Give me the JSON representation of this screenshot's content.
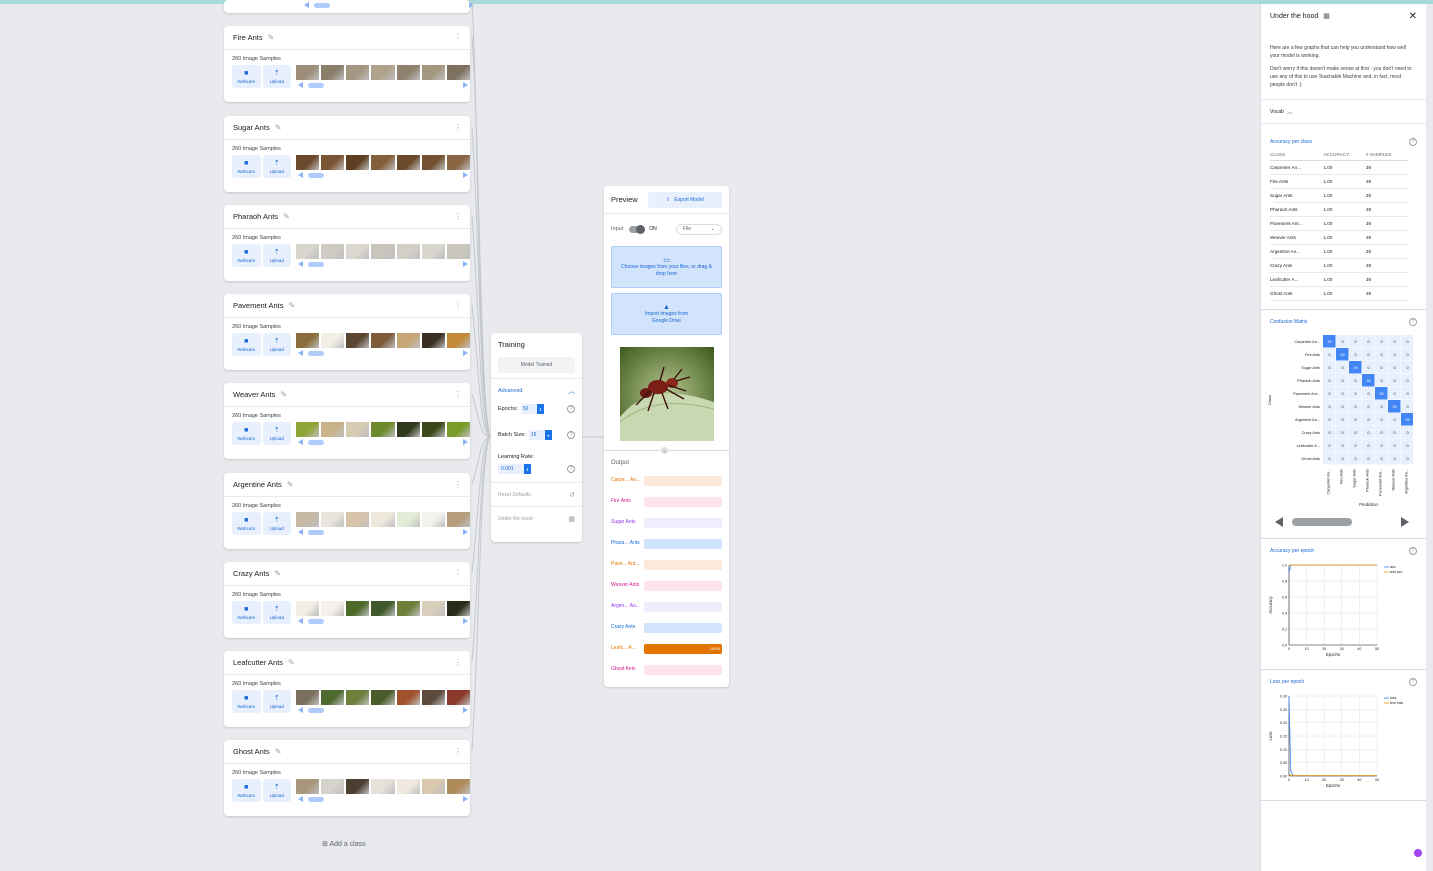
{
  "colors": {
    "accent": "#1a73e8",
    "orange": "#e37400",
    "pink": "#d01884",
    "purple": "#9334e6",
    "blue": "#1967d2"
  },
  "classes": [
    {
      "name": "Fire Ants",
      "samples": "260 Image Samples",
      "palette": [
        "#9c8c78",
        "#8a7d6a",
        "#a59883",
        "#b1a28b",
        "#8e826f",
        "#a4977f",
        "#7d705f"
      ]
    },
    {
      "name": "Sugar Ants",
      "samples": "260 Image Samples",
      "palette": [
        "#6b4a2b",
        "#7a5533",
        "#5e3f22",
        "#83603c",
        "#6a4a2a",
        "#735030",
        "#8a6644"
      ]
    },
    {
      "name": "Pharaoh Ants",
      "samples": "260 Image Samples",
      "palette": [
        "#d8d4ce",
        "#cfcbc4",
        "#dcd8d1",
        "#c9c4bc",
        "#d3cec7",
        "#d9d5cf",
        "#cbc6be"
      ]
    },
    {
      "name": "Pavement Ants",
      "samples": "260 Image Samples",
      "palette": [
        "#8a6d3b",
        "#f3efe6",
        "#5a4632",
        "#7e5c3a",
        "#c7a676",
        "#3b2e22",
        "#c48a3c"
      ]
    },
    {
      "name": "Weaver Ants",
      "samples": "260 Image Samples",
      "palette": [
        "#8fa53a",
        "#c9b48a",
        "#d6cbb3",
        "#6e8a2e",
        "#2f3a1d",
        "#3c4a1a",
        "#7a9b2a"
      ]
    },
    {
      "name": "Argentine Ants",
      "samples": "260 Image Samples",
      "palette": [
        "#c6b8a4",
        "#e9e4dc",
        "#d6c3a9",
        "#efe8dc",
        "#e3ecd6",
        "#f4f2ee",
        "#b59d7c"
      ]
    },
    {
      "name": "Crazy Ants",
      "samples": "260 Image Samples",
      "palette": [
        "#f1ece4",
        "#f5f1ea",
        "#4e6a2a",
        "#3e5a2a",
        "#6f7f3a",
        "#d9cdbb",
        "#2a2a1a"
      ]
    },
    {
      "name": "Leafcutter Ants",
      "samples": "260 Image Samples",
      "palette": [
        "#7a6e5c",
        "#4f6a2e",
        "#6d7f3a",
        "#4a5c2a",
        "#a0522d",
        "#5e4a3a",
        "#8a3a2a"
      ]
    },
    {
      "name": "Ghost Ants",
      "samples": "260 Image Samples",
      "palette": [
        "#a8967a",
        "#d6d2cc",
        "#4a3f30",
        "#e6e1d9",
        "#efe9df",
        "#d9c8ae",
        "#b08b5a"
      ]
    }
  ],
  "buttons": {
    "webcam": "Webcam",
    "upload": "Upload"
  },
  "add_class": "Add a class",
  "training": {
    "title": "Training",
    "status": "Model Trained",
    "advanced": "Advanced",
    "epochs_label": "Epochs:",
    "epochs_value": "50",
    "batch_label": "Batch Size:",
    "batch_value": "16",
    "lr_label": "Learning Rate:",
    "lr_value": "0.001",
    "reset": "Reset Defaults",
    "under_hood": "Under the hood"
  },
  "preview": {
    "title": "Preview",
    "export": "Export Model",
    "input_label": "Input",
    "toggle_state": "ON",
    "source": "File",
    "upload_text": "Choose images from your files, or drag & drop here",
    "drive_text": "Import images from Google Drive",
    "output_label": "Output",
    "outputs": [
      {
        "name": "Carpe... An...",
        "color": "#e37400",
        "bg": "#fde8dc",
        "value": 0
      },
      {
        "name": "Fire Ants",
        "color": "#d01884",
        "bg": "#fce4ec",
        "value": 0
      },
      {
        "name": "Sugar Ants",
        "color": "#9334e6",
        "bg": "#eeeefc",
        "value": 0
      },
      {
        "name": "Phara... Ants",
        "color": "#1967d2",
        "bg": "#d2e3fc",
        "value": 0
      },
      {
        "name": "Pave... Ant...",
        "color": "#e37400",
        "bg": "#fde8dc",
        "value": 0
      },
      {
        "name": "Weaver Ants",
        "color": "#d01884",
        "bg": "#fce4ec",
        "value": 0
      },
      {
        "name": "Argen... An...",
        "color": "#9334e6",
        "bg": "#eeeefc",
        "value": 0
      },
      {
        "name": "Crazy Ants",
        "color": "#1967d2",
        "bg": "#d2e3fc",
        "value": 0
      },
      {
        "name": "Leafc... A...",
        "color": "#e37400",
        "bg": "#fde8dc",
        "value": 100,
        "label": "100%"
      },
      {
        "name": "Ghost Ants",
        "color": "#d01884",
        "bg": "#fce4ec",
        "value": 0
      }
    ]
  },
  "side": {
    "title": "Under the hood",
    "intro1": "Here are a few graphs that can help you understand how well your model is working.",
    "intro2": "Don't worry if this doesn't make sense at first - you don't need to use any of this to use Teachable Machine and, in fact, most people don't :)",
    "vocab": "Vocab",
    "accuracy_title": "Accuracy per class",
    "table_headers": [
      "CLASS",
      "ACCURACY",
      "# SAMPLES"
    ],
    "table_rows": [
      [
        "Carpenter An...",
        "1.00",
        "39"
      ],
      [
        "Fire Ants",
        "1.00",
        "39"
      ],
      [
        "Sugar Ants",
        "1.00",
        "39"
      ],
      [
        "Pharaoh Ants",
        "1.00",
        "39"
      ],
      [
        "Pavement Ant...",
        "1.00",
        "39"
      ],
      [
        "Weaver Ants",
        "1.00",
        "39"
      ],
      [
        "Argentine An...",
        "1.00",
        "39"
      ],
      [
        "Crazy Ants",
        "1.00",
        "39"
      ],
      [
        "Leafcutter A...",
        "1.00",
        "39"
      ],
      [
        "Ghost Ants",
        "1.00",
        "39"
      ]
    ],
    "confusion_title": "Confusion Matrix",
    "acc_epoch_title": "Accuracy per epoch",
    "loss_epoch_title": "Loss per epoch"
  },
  "chart_data": [
    {
      "type": "heatmap",
      "title": "Confusion Matrix",
      "ylabel": "Class",
      "xlabel": "Prediction",
      "rows": [
        "Carpenter An...",
        "Fire Ants",
        "Sugar Ants",
        "Pharaoh Ants",
        "Pavement Ant...",
        "Weaver Ants",
        "Argentine An...",
        "Crazy Ants",
        "Leafcutter A...",
        "Ghost Ants"
      ],
      "cols": [
        "Carpenter An...",
        "Fire Ants",
        "Sugar Ants",
        "Pharaoh Ants",
        "Pavement Ant...",
        "Weaver Ants",
        "Argentine An..."
      ],
      "diagonal_value": 39,
      "off_value": 0
    },
    {
      "type": "line",
      "title": "Accuracy per epoch",
      "xlabel": "Epochs",
      "ylabel": "Accuracy",
      "xlim": [
        0,
        50
      ],
      "ylim": [
        0,
        1
      ],
      "xticks": [
        "0",
        "10",
        "20",
        "30",
        "40",
        "50"
      ],
      "yticks": [
        "0.0",
        "0.2",
        "0.4",
        "0.6",
        "0.8",
        "1.0"
      ],
      "series": [
        {
          "name": "acc",
          "color": "#4285f4",
          "x": [
            0,
            1,
            2,
            5,
            10,
            20,
            30,
            40,
            50
          ],
          "y": [
            0.9,
            1,
            1,
            1,
            1,
            1,
            1,
            1,
            1
          ]
        },
        {
          "name": "test acc",
          "color": "#f29900",
          "x": [
            0,
            1,
            2,
            5,
            10,
            20,
            30,
            40,
            50
          ],
          "y": [
            1,
            1,
            1,
            1,
            1,
            1,
            1,
            1,
            1
          ]
        }
      ]
    },
    {
      "type": "line",
      "title": "Loss per epoch",
      "xlabel": "Epochs",
      "ylabel": "Loss",
      "xlim": [
        0,
        50
      ],
      "ylim": [
        0,
        0.3
      ],
      "xticks": [
        "0",
        "10",
        "20",
        "30",
        "40",
        "50"
      ],
      "yticks": [
        "0.00",
        "0.05",
        "0.10",
        "0.15",
        "0.20",
        "0.25",
        "0.30"
      ],
      "series": [
        {
          "name": "loss",
          "color": "#4285f4",
          "x": [
            0,
            1,
            2,
            3,
            5,
            10,
            20,
            30,
            40,
            50
          ],
          "y": [
            0.3,
            0.02,
            0.005,
            0.002,
            0.001,
            0.001,
            0.001,
            0.001,
            0.001,
            0.001
          ]
        },
        {
          "name": "test loss",
          "color": "#f29900",
          "x": [
            0,
            1,
            2,
            5,
            10,
            20,
            30,
            40,
            50
          ],
          "y": [
            0.005,
            0.003,
            0.002,
            0.002,
            0.002,
            0.002,
            0.002,
            0.002,
            0.002
          ]
        }
      ]
    }
  ]
}
